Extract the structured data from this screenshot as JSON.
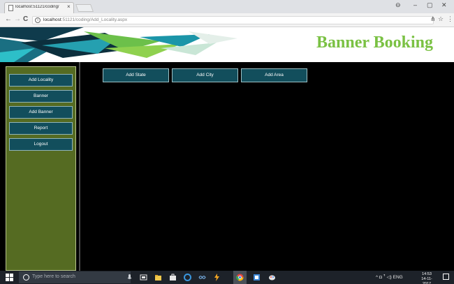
{
  "browser": {
    "tab_title": "localhost:51121/coding/",
    "tab_close": "×",
    "url_host": "localhost",
    "url_rest": ":51121/coding/Add_Locality.aspx",
    "window_controls": {
      "account": "⊖",
      "minimize": "–",
      "maximize": "▢",
      "close": "✕"
    },
    "nav": {
      "back": "←",
      "forward": "→",
      "reload": "C"
    },
    "toolbar_icons": {
      "tab_search": "⋔",
      "bookmark": "☆",
      "menu": "⋮"
    }
  },
  "header": {
    "site_title": "Banner Booking"
  },
  "sidebar": {
    "items": [
      {
        "label": "Add Locality"
      },
      {
        "label": "Banner"
      },
      {
        "label": "Add Banner"
      },
      {
        "label": "Report"
      },
      {
        "label": "Logout"
      }
    ]
  },
  "main": {
    "buttons": [
      {
        "label": "Add State"
      },
      {
        "label": "Add City"
      },
      {
        "label": "Add Area"
      }
    ]
  },
  "taskbar": {
    "search_placeholder": "Type here to search",
    "tray_text": "^ ◘ ꜛ ◁) ENG",
    "time": "14:53",
    "date": "14-11-2017"
  },
  "colors": {
    "accent_title": "#7ac143",
    "button_bg": "#124e5c",
    "sidebar_bg": "#556b22",
    "page_bg": "#000000"
  }
}
